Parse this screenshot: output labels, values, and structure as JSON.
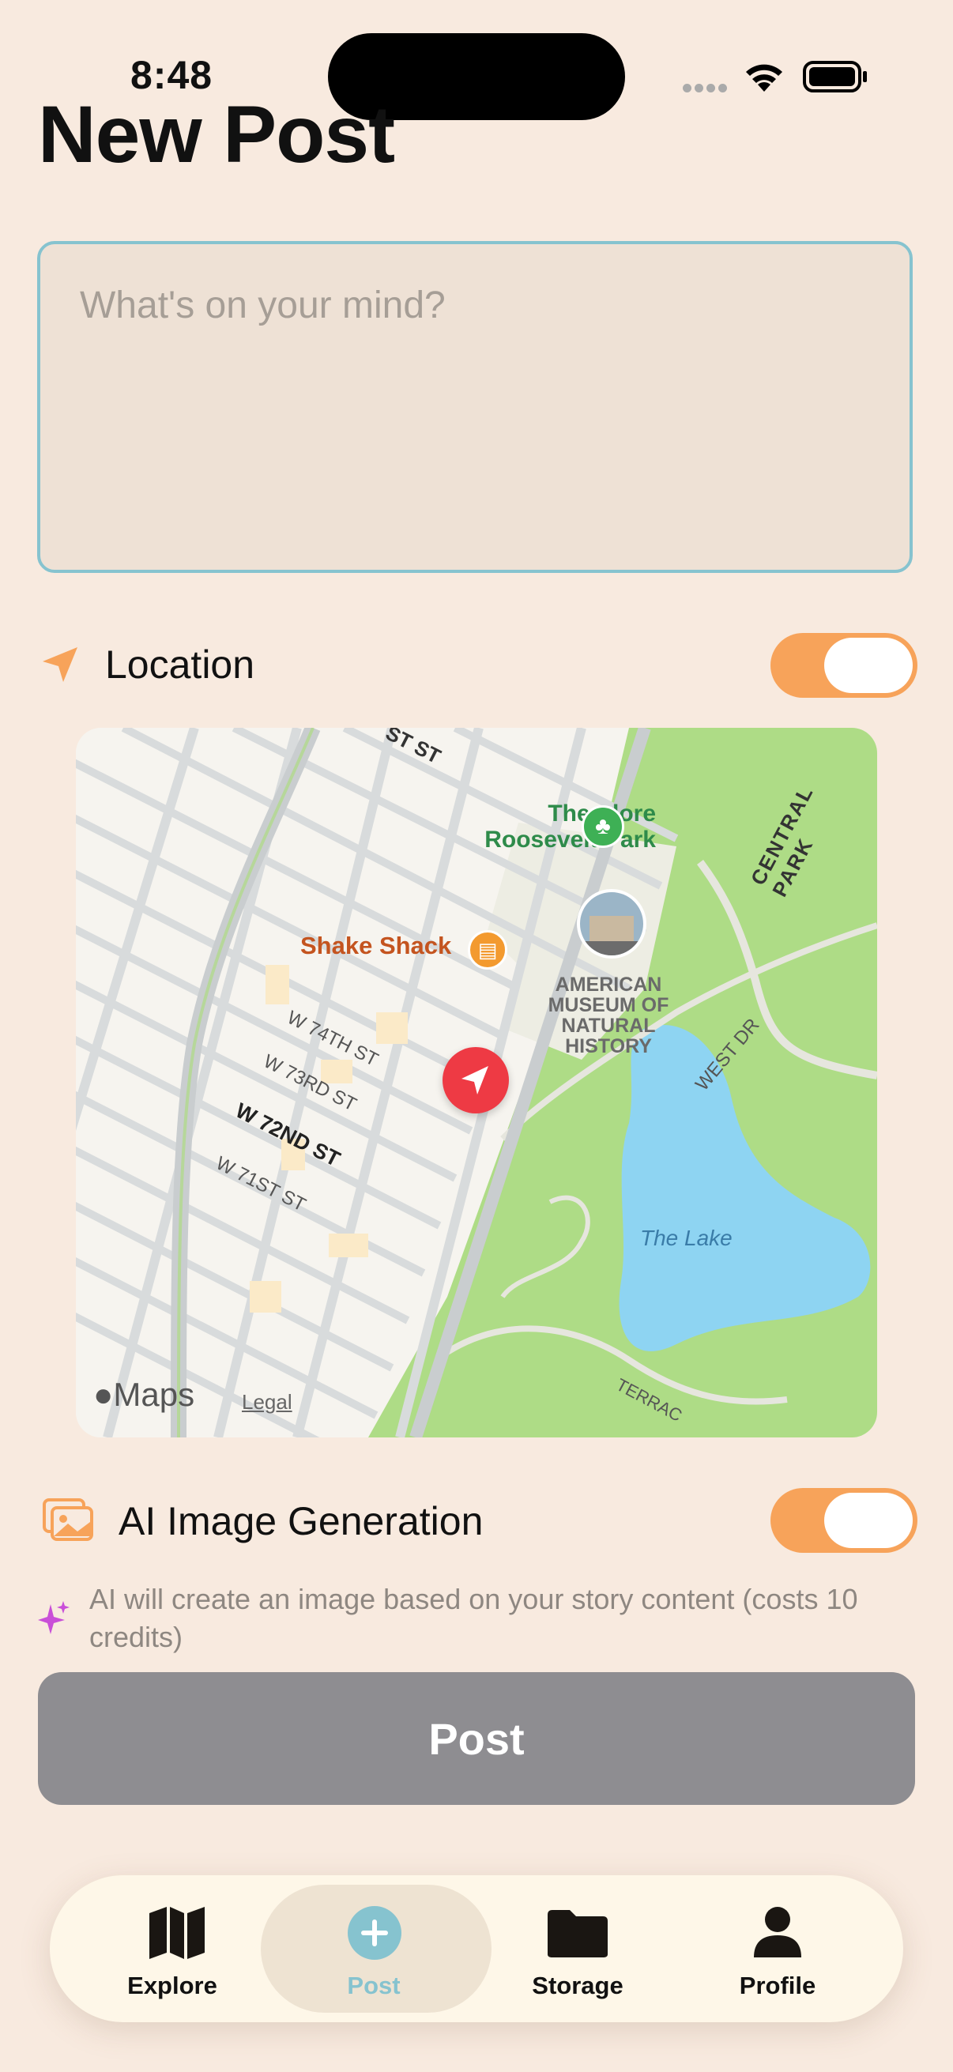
{
  "status_bar": {
    "time": "8:48"
  },
  "header": {
    "title": "New Post"
  },
  "composer": {
    "placeholder": "What's on your mind?",
    "value": ""
  },
  "location": {
    "label": "Location",
    "enabled": true,
    "icon": "location-arrow-icon"
  },
  "map": {
    "labels": {
      "park": "Theodore Roosevelt Park",
      "park_line1": "Theodore",
      "park_line2": "Roosevelt Park",
      "shake_shack": "Shake Shack",
      "museum_l1": "AMERICAN",
      "museum_l2": "MUSEUM OF",
      "museum_l3": "NATURAL",
      "museum_l4": "HISTORY",
      "central_park": "CENTRAL PARK",
      "st81": "ST ST",
      "w74": "W 74TH ST",
      "w73": "W 73RD ST",
      "w72": "W 72ND ST",
      "w71": "W 71ST ST",
      "west_dr": "WEST DR",
      "lake": "The Lake",
      "terrace": "TERRAC",
      "maps_brand": "Maps",
      "legal": "Legal"
    }
  },
  "ai_image": {
    "label": "AI Image Generation",
    "enabled": true,
    "icon": "photos-icon",
    "note": "AI will create an image based on your story content (costs 10 credits)",
    "note_icon": "sparkles-icon"
  },
  "post_button": {
    "label": "Post"
  },
  "tabbar": {
    "tabs": [
      {
        "label": "Explore",
        "icon": "map-icon",
        "active": false
      },
      {
        "label": "Post",
        "icon": "plus-circle-icon",
        "active": true
      },
      {
        "label": "Storage",
        "icon": "folder-icon",
        "active": false
      },
      {
        "label": "Profile",
        "icon": "person-icon",
        "active": false
      }
    ]
  },
  "colors": {
    "background": "#F8EADF",
    "accent_orange": "#F7A35A",
    "accent_teal": "#86C3CF",
    "button_disabled": "#8E8D91",
    "tabbar": "#FEF7E8"
  }
}
